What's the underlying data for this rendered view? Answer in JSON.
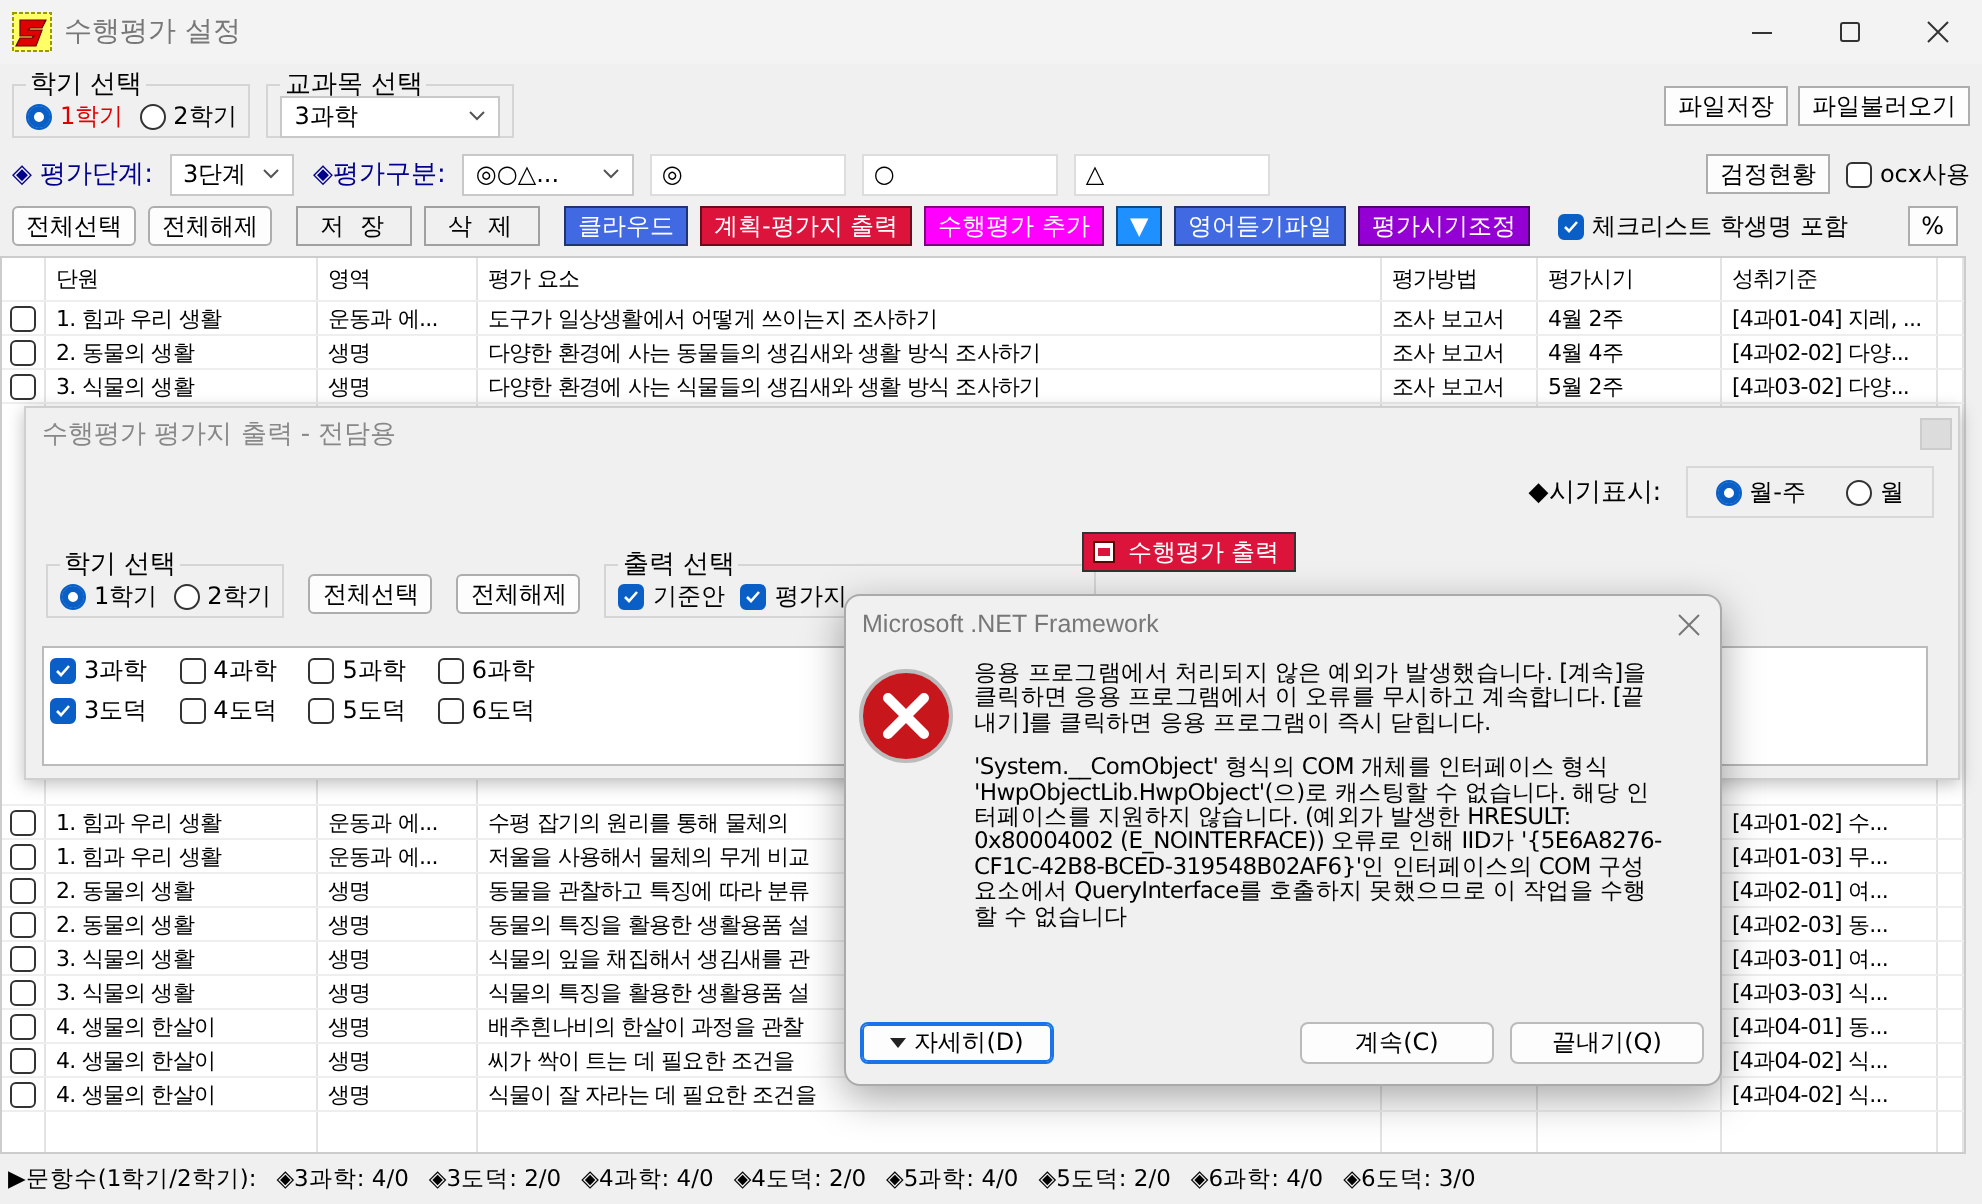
{
  "window": {
    "title": "수행평가 설정"
  },
  "semester_group": {
    "label": "학기 선택",
    "options": [
      {
        "label": "1학기",
        "selected": true
      },
      {
        "label": "2학기",
        "selected": false
      }
    ]
  },
  "subject_group": {
    "label": "교과목 선택",
    "value": "3과학"
  },
  "file_buttons": [
    "파일저장",
    "파일불러오기"
  ],
  "eval_level": {
    "label": "◈ 평가단계:",
    "value": "3단계"
  },
  "eval_type": {
    "label": "◈평가구분:",
    "value": "◎○△..."
  },
  "symbol_fields": [
    "◎",
    "○",
    "△"
  ],
  "status_button": "검정현황",
  "ocx_option": {
    "label": "ocx사용",
    "checked": false
  },
  "toolbar": [
    {
      "label": "전체선택",
      "kind": "plain"
    },
    {
      "label": "전체해제",
      "kind": "plain"
    },
    {
      "label": "저 장",
      "kind": "flat"
    },
    {
      "label": "삭 제",
      "kind": "flat"
    },
    {
      "label": "클라우드",
      "kind": "colored",
      "color": "#4169e1"
    },
    {
      "label": "계획-평가지 출력",
      "kind": "colored",
      "color": "#dc143c"
    },
    {
      "label": "수행평가 추가",
      "kind": "colored",
      "color": "#ff00ff"
    },
    {
      "label": "▼",
      "kind": "colored",
      "color": "#1e90ff"
    },
    {
      "label": "영어듣기파일",
      "kind": "colored",
      "color": "#4169e1"
    },
    {
      "label": "평가시기조정",
      "kind": "colored",
      "color": "#9400d3"
    }
  ],
  "checklist_option": {
    "label": "체크리스트 학생명 포함",
    "checked": true
  },
  "percent_button": "%",
  "table": {
    "columns": [
      "단원",
      "영역",
      "평가 요소",
      "평가방법",
      "평가시기",
      "성취기준"
    ],
    "rows": [
      {
        "checked": false,
        "cells": [
          "1. 힘과 우리 생활",
          "운동과 에...",
          "도구가 일상생활에서 어떻게 쓰이는지 조사하기",
          "조사 보고서",
          "4월 2주",
          "[4과01-04] 지레, ..."
        ]
      },
      {
        "checked": false,
        "cells": [
          "2. 동물의 생활",
          "생명",
          "다양한 환경에 사는 동물들의 생김새와 생활 방식 조사하기",
          "조사 보고서",
          "4월 4주",
          "[4과02-02] 다양..."
        ]
      },
      {
        "checked": false,
        "cells": [
          "3. 식물의 생활",
          "생명",
          "다양한 환경에 사는 식물들의 생김새와 생활 방식 조사하기",
          "조사 보고서",
          "5월 2주",
          "[4과03-02] 다양..."
        ]
      }
    ],
    "lower_rows": [
      {
        "checked": false,
        "cells": [
          "1. 힘과 우리 생활",
          "운동과 에...",
          "수평 잡기의 원리를 통해 물체의",
          "",
          "",
          "[4과01-02] 수..."
        ]
      },
      {
        "checked": false,
        "cells": [
          "1. 힘과 우리 생활",
          "운동과 에...",
          "저울을 사용해서 물체의 무게 비교",
          "",
          "",
          "[4과01-03] 무..."
        ]
      },
      {
        "checked": false,
        "cells": [
          "2. 동물의 생활",
          "생명",
          "동물을 관찰하고 특징에 따라 분류",
          "",
          "",
          "[4과02-01] 여..."
        ]
      },
      {
        "checked": false,
        "cells": [
          "2. 동물의 생활",
          "생명",
          "동물의 특징을 활용한 생활용품 설",
          "",
          "",
          "[4과02-03] 동..."
        ]
      },
      {
        "checked": false,
        "cells": [
          "3. 식물의 생활",
          "생명",
          "식물의 잎을 채집해서 생김새를 관",
          "",
          "",
          "[4과03-01] 여..."
        ]
      },
      {
        "checked": false,
        "cells": [
          "3. 식물의 생활",
          "생명",
          "식물의 특징을 활용한 생활용품 설",
          "",
          "",
          "[4과03-03] 식..."
        ]
      },
      {
        "checked": false,
        "cells": [
          "4. 생물의 한살이",
          "생명",
          "배추흰나비의 한살이 과정을 관찰",
          "",
          "",
          "[4과04-01] 동..."
        ]
      },
      {
        "checked": false,
        "cells": [
          "4. 생물의 한살이",
          "생명",
          "씨가 싹이 트는 데 필요한 조건을",
          "",
          "",
          "[4과04-02] 식..."
        ]
      },
      {
        "checked": false,
        "cells": [
          "4. 생물의 한살이",
          "생명",
          "식물이 잘 자라는 데 필요한 조건을",
          "",
          "",
          "[4과04-02] 식..."
        ]
      }
    ]
  },
  "status_bar": {
    "label": "▶문항수(1학기/2학기):",
    "items": [
      "◈3과학: 4/0",
      "◈3도덕: 2/0",
      "◈4과학: 4/0",
      "◈4도덕: 2/0",
      "◈5과학: 4/0",
      "◈5도덕: 2/0",
      "◈6과학: 4/0",
      "◈6도덕: 3/0"
    ]
  },
  "print_dialog": {
    "title": "수행평가 평가지 출력 - 전담용",
    "timing_display": {
      "label": "◆시기표시:",
      "options": [
        {
          "label": "월-주",
          "selected": true
        },
        {
          "label": "월",
          "selected": false
        }
      ]
    },
    "semester_group": {
      "label": "학기 선택",
      "options": [
        {
          "label": "1학기",
          "selected": true
        },
        {
          "label": "2학기",
          "selected": false
        }
      ]
    },
    "buttons": [
      "전체선택",
      "전체해제"
    ],
    "output_group": {
      "label": "출력 선택",
      "options": [
        {
          "label": "기준안",
          "checked": true
        },
        {
          "label": "평가지",
          "checked": true
        }
      ]
    },
    "print_button": "수행평가 출력",
    "subjects": [
      {
        "label": "3과학",
        "checked": true
      },
      {
        "label": "4과학",
        "checked": false
      },
      {
        "label": "5과학",
        "checked": false
      },
      {
        "label": "6과학",
        "checked": false
      },
      {
        "label": "3도덕",
        "checked": true
      },
      {
        "label": "4도덕",
        "checked": false
      },
      {
        "label": "5도덕",
        "checked": false
      },
      {
        "label": "6도덕",
        "checked": false
      }
    ]
  },
  "error_dialog": {
    "title": "Microsoft .NET Framework",
    "paragraphs": [
      "응용 프로그램에서 처리되지 않은 예외가 발생했습니다. [계속]을 클릭하면 응용 프로그램에서 이 오류를 무시하고 계속합니다. [끝내기]를 클릭하면 응용 프로그램이 즉시 닫힙니다.",
      "'System.__ComObject' 형식의 COM 개체를 인터페이스 형식 'HwpObjectLib.HwpObject'(으)로 캐스팅할 수 없습니다. 해당 인터페이스를 지원하지 않습니다. (예외가 발생한 HRESULT: 0x80004002 (E_NOINTERFACE)) 오류로 인해 IID가 '{5E6A8276-CF1C-42B8-BCED-319548B02AF6}'인 인터페이스의 COM 구성 요소에서 QueryInterface를 호출하지 못했으므로 이 작업을 수행할 수 없습니다"
    ],
    "details_button": "자세히(D)",
    "buttons": [
      "계속(C)",
      "끝내기(Q)"
    ]
  }
}
